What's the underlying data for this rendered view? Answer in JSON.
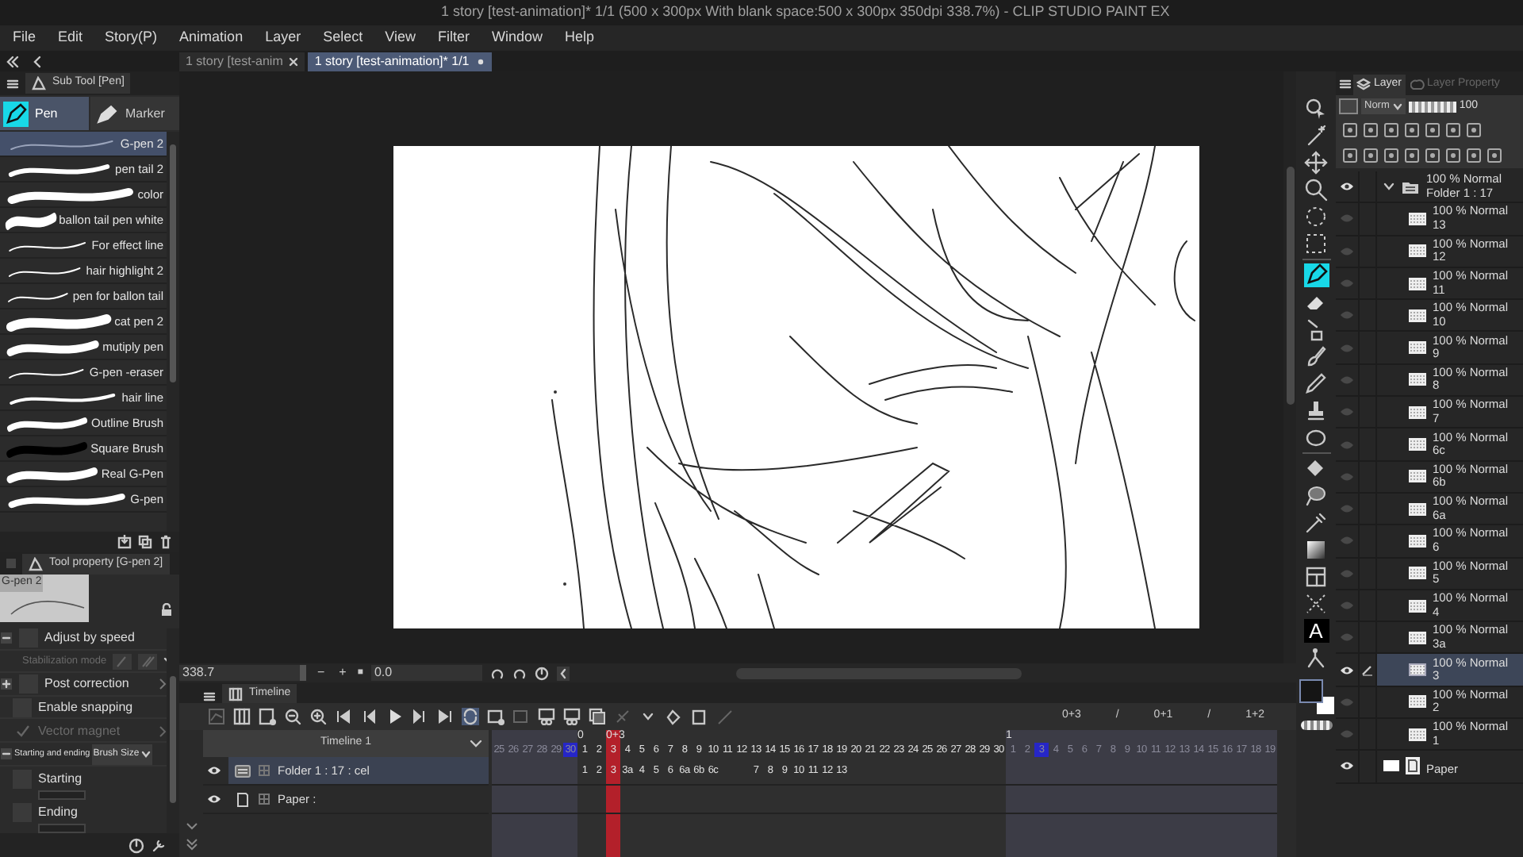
{
  "title_bar": {
    "title": "1 story [test-animation]* 1/1 (500 x 300px With blank space:500 x 300px 350dpi 338.7%) - CLIP STUDIO PAINT EX"
  },
  "menu": [
    "File",
    "Edit",
    "Story(P)",
    "Animation",
    "Layer",
    "Select",
    "View",
    "Filter",
    "Window",
    "Help"
  ],
  "doc_tabs": [
    {
      "label": "1 story [test-anim",
      "selected": false
    },
    {
      "label": "1 story [test-animation]* 1/1",
      "selected": true
    }
  ],
  "sub_tool_panel": {
    "title": "Sub Tool [Pen]",
    "groups": [
      {
        "label": "Pen",
        "selected": true
      },
      {
        "label": "Marker",
        "selected": false
      }
    ],
    "brushes": [
      {
        "name": "G-pen 2",
        "selected": true
      },
      {
        "name": "pen tail 2",
        "selected": false
      },
      {
        "name": "color",
        "selected": false
      },
      {
        "name": "ballon tail pen white",
        "selected": false
      },
      {
        "name": "For effect line",
        "selected": false
      },
      {
        "name": "hair highlight 2",
        "selected": false
      },
      {
        "name": "pen for ballon tail",
        "selected": false
      },
      {
        "name": "cat pen 2",
        "selected": false
      },
      {
        "name": "mutiply pen",
        "selected": false
      },
      {
        "name": "G-pen -eraser",
        "selected": false
      },
      {
        "name": "hair line",
        "selected": false
      },
      {
        "name": "Outline Brush",
        "selected": false
      },
      {
        "name": "Square Brush",
        "selected": false
      },
      {
        "name": "Real G-Pen",
        "selected": false
      },
      {
        "name": "G-pen",
        "selected": false
      }
    ]
  },
  "tool_property": {
    "title": "Tool property [G-pen 2]",
    "preview_label": "G-pen 2",
    "rows": [
      {
        "kind": "group",
        "label": "Adjust by speed",
        "checked": false
      },
      {
        "kind": "option",
        "label": "Stabilization mode",
        "disabled": true
      },
      {
        "kind": "group",
        "label": "Post correction",
        "checked": false
      },
      {
        "kind": "check",
        "label": "Enable snapping",
        "checked": false,
        "disabled": false
      },
      {
        "kind": "check",
        "label": "Vector magnet",
        "checked": true,
        "disabled": true
      },
      {
        "kind": "select",
        "label": "Starting and ending",
        "value": "Brush Size"
      },
      {
        "kind": "sub",
        "label": "Starting",
        "checked": false
      },
      {
        "kind": "sub",
        "label": "Ending",
        "checked": false
      }
    ]
  },
  "navigator": {
    "zoom": "338.7",
    "zoom_out": "−",
    "zoom_in": "+",
    "fit": "■",
    "angle": "0.0"
  },
  "timeline": {
    "tab": "Timeline",
    "name": "Timeline 1",
    "timing": [
      "0+3",
      "/",
      "0+1",
      "/",
      "1+2"
    ],
    "sections": [
      {
        "kind": "previous",
        "frames": [
          {
            "label": "25",
            "selected": false
          },
          {
            "label": "26",
            "selected": false
          },
          {
            "label": "27",
            "selected": false
          },
          {
            "label": "28",
            "selected": false
          },
          {
            "label": "29",
            "selected": false
          },
          {
            "label": "30",
            "selected": true
          }
        ]
      },
      {
        "kind": "main",
        "frames": [
          {
            "label": "1",
            "mark": "0",
            "cel": "1",
            "selected": false
          },
          {
            "label": "2",
            "cel": "2",
            "selected": false
          },
          {
            "label": "3",
            "mark": "0+3",
            "cel": "3",
            "selected": true
          },
          {
            "label": "4",
            "cel": "3a",
            "selected": false
          },
          {
            "label": "5",
            "cel": "4",
            "selected": false
          },
          {
            "label": "6",
            "cel": "5",
            "selected": false
          },
          {
            "label": "7",
            "cel": "6",
            "selected": false
          },
          {
            "label": "8",
            "cel": "6a",
            "selected": false
          },
          {
            "label": "9",
            "cel": "6b",
            "selected": false
          },
          {
            "label": "10",
            "cel": "6c",
            "selected": false
          },
          {
            "label": "11",
            "selected": false
          },
          {
            "label": "12",
            "selected": false
          },
          {
            "label": "13",
            "cel": "7",
            "selected": false
          },
          {
            "label": "14",
            "cel": "8",
            "selected": false
          },
          {
            "label": "15",
            "cel": "9",
            "selected": false
          },
          {
            "label": "16",
            "cel": "10",
            "selected": false
          },
          {
            "label": "17",
            "cel": "11",
            "selected": false
          },
          {
            "label": "18",
            "cel": "12",
            "selected": false
          },
          {
            "label": "19",
            "cel": "13",
            "selected": false
          },
          {
            "label": "20",
            "selected": false
          },
          {
            "label": "21",
            "selected": false
          },
          {
            "label": "22",
            "selected": false
          },
          {
            "label": "23",
            "selected": false
          },
          {
            "label": "24",
            "selected": false
          },
          {
            "label": "25",
            "selected": false
          },
          {
            "label": "26",
            "selected": false
          },
          {
            "label": "27",
            "selected": false
          },
          {
            "label": "28",
            "selected": false
          },
          {
            "label": "29",
            "selected": false
          },
          {
            "label": "30",
            "selected": false
          }
        ]
      },
      {
        "kind": "next",
        "frames": [
          {
            "label": "1",
            "mark": "1",
            "selected": false
          },
          {
            "label": "2",
            "selected": false
          },
          {
            "label": "3",
            "selected": true
          },
          {
            "label": "4",
            "selected": false
          },
          {
            "label": "5",
            "selected": false
          },
          {
            "label": "6",
            "selected": false
          },
          {
            "label": "7",
            "selected": false
          },
          {
            "label": "8",
            "selected": false
          },
          {
            "label": "9",
            "selected": false
          },
          {
            "label": "10",
            "selected": false
          },
          {
            "label": "11",
            "selected": false
          },
          {
            "label": "12",
            "selected": false
          },
          {
            "label": "13",
            "selected": false
          },
          {
            "label": "14",
            "selected": false
          },
          {
            "label": "15",
            "selected": false
          },
          {
            "label": "16",
            "selected": false
          },
          {
            "label": "17",
            "selected": false
          },
          {
            "label": "18",
            "selected": false
          },
          {
            "label": "19",
            "selected": false
          }
        ]
      }
    ],
    "tracks": [
      {
        "name": "Folder 1 : 17 : cel",
        "kind": "folder",
        "selected": true,
        "visible": true
      },
      {
        "name": "Paper :",
        "kind": "paper",
        "selected": false,
        "visible": true
      }
    ]
  },
  "tools": [
    {
      "selected": false
    },
    {
      "selected": false
    },
    {
      "selected": false
    },
    {
      "selected": false
    },
    {
      "selected": false
    },
    {
      "selected": false
    },
    {
      "selected": true
    },
    {
      "selected": false
    },
    {
      "selected": false
    },
    {
      "selected": false
    },
    {
      "selected": false
    },
    {
      "selected": false
    },
    {
      "selected": false
    },
    {
      "selected": false
    },
    {
      "selected": false
    },
    {
      "selected": false
    },
    {
      "selected": false
    },
    {
      "selected": false
    },
    {
      "selected": false
    },
    {
      "selected": false,
      "glyph": "A"
    },
    {
      "selected": false
    }
  ],
  "layer_panel": {
    "tabs": [
      {
        "label": "Layer",
        "selected": true
      },
      {
        "label": "Layer Property",
        "selected": false
      }
    ],
    "blend_mode": "Norm",
    "opacity": "100",
    "opacity_slider": {
      "level": 1
    },
    "layers": [
      {
        "kind": "folder",
        "mode": "100 % Normal",
        "name": "Folder 1 : 17",
        "visible": true,
        "selected": false,
        "expanded": true,
        "children": [
          {
            "kind": "raster",
            "mode": "100 % Normal",
            "name": "13",
            "visible": false,
            "selected": false
          },
          {
            "kind": "raster",
            "mode": "100 % Normal",
            "name": "12",
            "visible": false,
            "selected": false
          },
          {
            "kind": "raster",
            "mode": "100 % Normal",
            "name": "11",
            "visible": false,
            "selected": false
          },
          {
            "kind": "raster",
            "mode": "100 % Normal",
            "name": "10",
            "visible": false,
            "selected": false
          },
          {
            "kind": "raster",
            "mode": "100 % Normal",
            "name": "9",
            "visible": false,
            "selected": false
          },
          {
            "kind": "raster",
            "mode": "100 % Normal",
            "name": "8",
            "visible": false,
            "selected": false
          },
          {
            "kind": "raster",
            "mode": "100 % Normal",
            "name": "7",
            "visible": false,
            "selected": false
          },
          {
            "kind": "raster",
            "mode": "100 % Normal",
            "name": "6c",
            "visible": false,
            "selected": false
          },
          {
            "kind": "raster",
            "mode": "100 % Normal",
            "name": "6b",
            "visible": false,
            "selected": false
          },
          {
            "kind": "raster",
            "mode": "100 % Normal",
            "name": "6a",
            "visible": false,
            "selected": false
          },
          {
            "kind": "raster",
            "mode": "100 % Normal",
            "name": "6",
            "visible": false,
            "selected": false
          },
          {
            "kind": "raster",
            "mode": "100 % Normal",
            "name": "5",
            "visible": false,
            "selected": false
          },
          {
            "kind": "raster",
            "mode": "100 % Normal",
            "name": "4",
            "visible": false,
            "selected": false
          },
          {
            "kind": "raster",
            "mode": "100 % Normal",
            "name": "3a",
            "visible": false,
            "selected": false
          },
          {
            "kind": "raster",
            "mode": "100 % Normal",
            "name": "3",
            "visible": true,
            "selected": true
          },
          {
            "kind": "raster",
            "mode": "100 % Normal",
            "name": "2",
            "visible": false,
            "selected": false
          },
          {
            "kind": "raster",
            "mode": "100 % Normal",
            "name": "1",
            "visible": false,
            "selected": false
          }
        ]
      },
      {
        "kind": "paper",
        "name": "Paper",
        "visible": true,
        "selected": false
      }
    ]
  }
}
